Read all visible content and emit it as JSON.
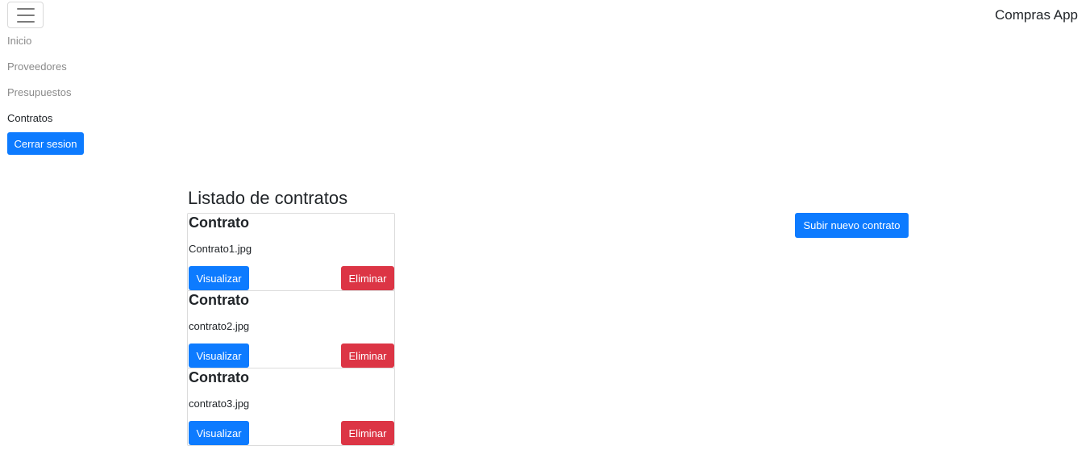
{
  "navbar": {
    "brand": "Compras App",
    "toggler_icon": "hamburger-menu-icon",
    "links": [
      {
        "label": "Inicio",
        "active": false
      },
      {
        "label": "Proveedores",
        "active": false
      },
      {
        "label": "Presupuestos",
        "active": false
      },
      {
        "label": "Contratos",
        "active": true
      }
    ],
    "logout_label": "Cerrar sesion"
  },
  "main": {
    "title": "Listado de contratos",
    "upload_label": "Subir nuevo contrato",
    "contracts": [
      {
        "title": "Contrato",
        "file": "Contrato1.jpg",
        "view_label": "Visualizar",
        "delete_label": "Eliminar"
      },
      {
        "title": "Contrato",
        "file": "contrato2.jpg",
        "view_label": "Visualizar",
        "delete_label": "Eliminar"
      },
      {
        "title": "Contrato",
        "file": "contrato3.jpg",
        "view_label": "Visualizar",
        "delete_label": "Eliminar"
      }
    ]
  },
  "colors": {
    "primary": "#0d7bff",
    "danger": "#dc3545",
    "nav_inactive": "#8a8a8a",
    "text": "#212529"
  }
}
